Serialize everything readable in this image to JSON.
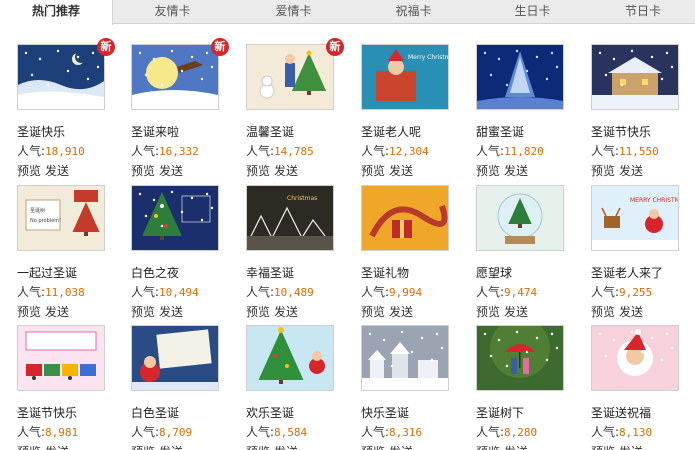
{
  "tabs": [
    {
      "label": "热门推荐",
      "active": true
    },
    {
      "label": "友情卡",
      "active": false
    },
    {
      "label": "爱情卡",
      "active": false
    },
    {
      "label": "祝福卡",
      "active": false
    },
    {
      "label": "生日卡",
      "active": false
    },
    {
      "label": "节日卡",
      "active": false
    }
  ],
  "labels": {
    "popularity": "人气:",
    "preview": "预览",
    "send": "发送",
    "new_badge": "新"
  },
  "cards": [
    {
      "title": "圣诞快乐",
      "popularity": "18,910",
      "is_new": true,
      "art": "night-snow"
    },
    {
      "title": "圣诞来啦",
      "popularity": "16,332",
      "is_new": true,
      "art": "moon-sleigh"
    },
    {
      "title": "温馨圣诞",
      "popularity": "14,785",
      "is_new": true,
      "art": "kid-tree"
    },
    {
      "title": "圣诞老人呢",
      "popularity": "12,304",
      "is_new": false,
      "art": "santa-card",
      "text": "Merry Christmas"
    },
    {
      "title": "甜蜜圣诞",
      "popularity": "11,820",
      "is_new": false,
      "art": "blue-spark"
    },
    {
      "title": "圣诞节快乐",
      "popularity": "11,550",
      "is_new": false,
      "art": "snow-house"
    },
    {
      "title": "一起过圣诞",
      "popularity": "11,038",
      "is_new": false,
      "art": "parcel",
      "text": "圣诞树 No problem!"
    },
    {
      "title": "白色之夜",
      "popularity": "10,494",
      "is_new": false,
      "art": "lit-tree"
    },
    {
      "title": "幸福圣诞",
      "popularity": "10,489",
      "is_new": false,
      "art": "sketch-town"
    },
    {
      "title": "圣诞礼物",
      "popularity": "9,994",
      "is_new": false,
      "art": "gift-swirl"
    },
    {
      "title": "愿望球",
      "popularity": "9,474",
      "is_new": false,
      "art": "wish-globe"
    },
    {
      "title": "圣诞老人来了",
      "popularity": "9,255",
      "is_new": false,
      "art": "reindeer",
      "text": "MERRY CHRISTMAS"
    },
    {
      "title": "圣诞节快乐",
      "popularity": "8,981",
      "is_new": false,
      "art": "train-pink"
    },
    {
      "title": "白色圣诞",
      "popularity": "8,709",
      "is_new": false,
      "art": "santa-blue"
    },
    {
      "title": "欢乐圣诞",
      "popularity": "8,584",
      "is_new": false,
      "art": "big-tree"
    },
    {
      "title": "快乐圣诞",
      "popularity": "8,316",
      "is_new": false,
      "art": "grey-town"
    },
    {
      "title": "圣诞树下",
      "popularity": "8,280",
      "is_new": false,
      "art": "couple-umbrella"
    },
    {
      "title": "圣诞送祝福",
      "popularity": "8,130",
      "is_new": false,
      "art": "santa-pink"
    }
  ],
  "colors": {
    "accent_number": "#e06a00",
    "badge": "#d6262b",
    "tabbar": "#ebebeb"
  }
}
